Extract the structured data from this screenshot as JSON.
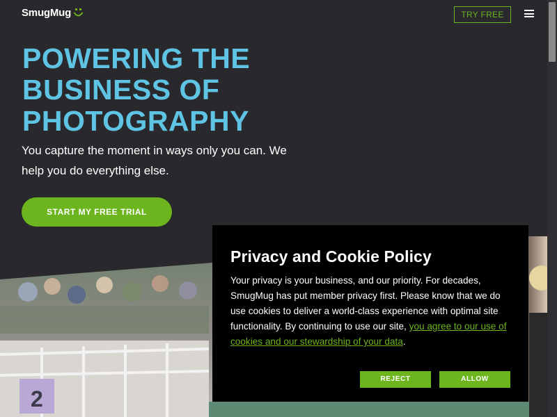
{
  "header": {
    "logo_text": "SmugMug",
    "logo_icon": "smile-icon",
    "try_free_label": "TRY FREE",
    "menu_icon": "hamburger-menu-icon"
  },
  "hero": {
    "title": "POWERING THE BUSINESS OF PHOTOGRAPHY",
    "subtitle": "You capture the moment in ways only you can. We help you do everything else.",
    "cta_label": "START MY FREE TRIAL"
  },
  "cookie_dialog": {
    "title": "Privacy and Cookie Policy",
    "body_text": "Your privacy is your business, and our priority. For decades, SmugMug has put member privacy first. Please know that we do use cookies to deliver a world-class experience with optimal site functionality. By continuing to use our site, ",
    "link_text": "you agree to our use of cookies and our stewardship of your data",
    "body_end": ".",
    "reject_label": "REJECT",
    "allow_label": "ALLOW"
  },
  "colors": {
    "background": "#29292d",
    "title_blue": "#5fc3e4",
    "brand_green": "#6db51f",
    "dialog_bg": "#000000"
  }
}
